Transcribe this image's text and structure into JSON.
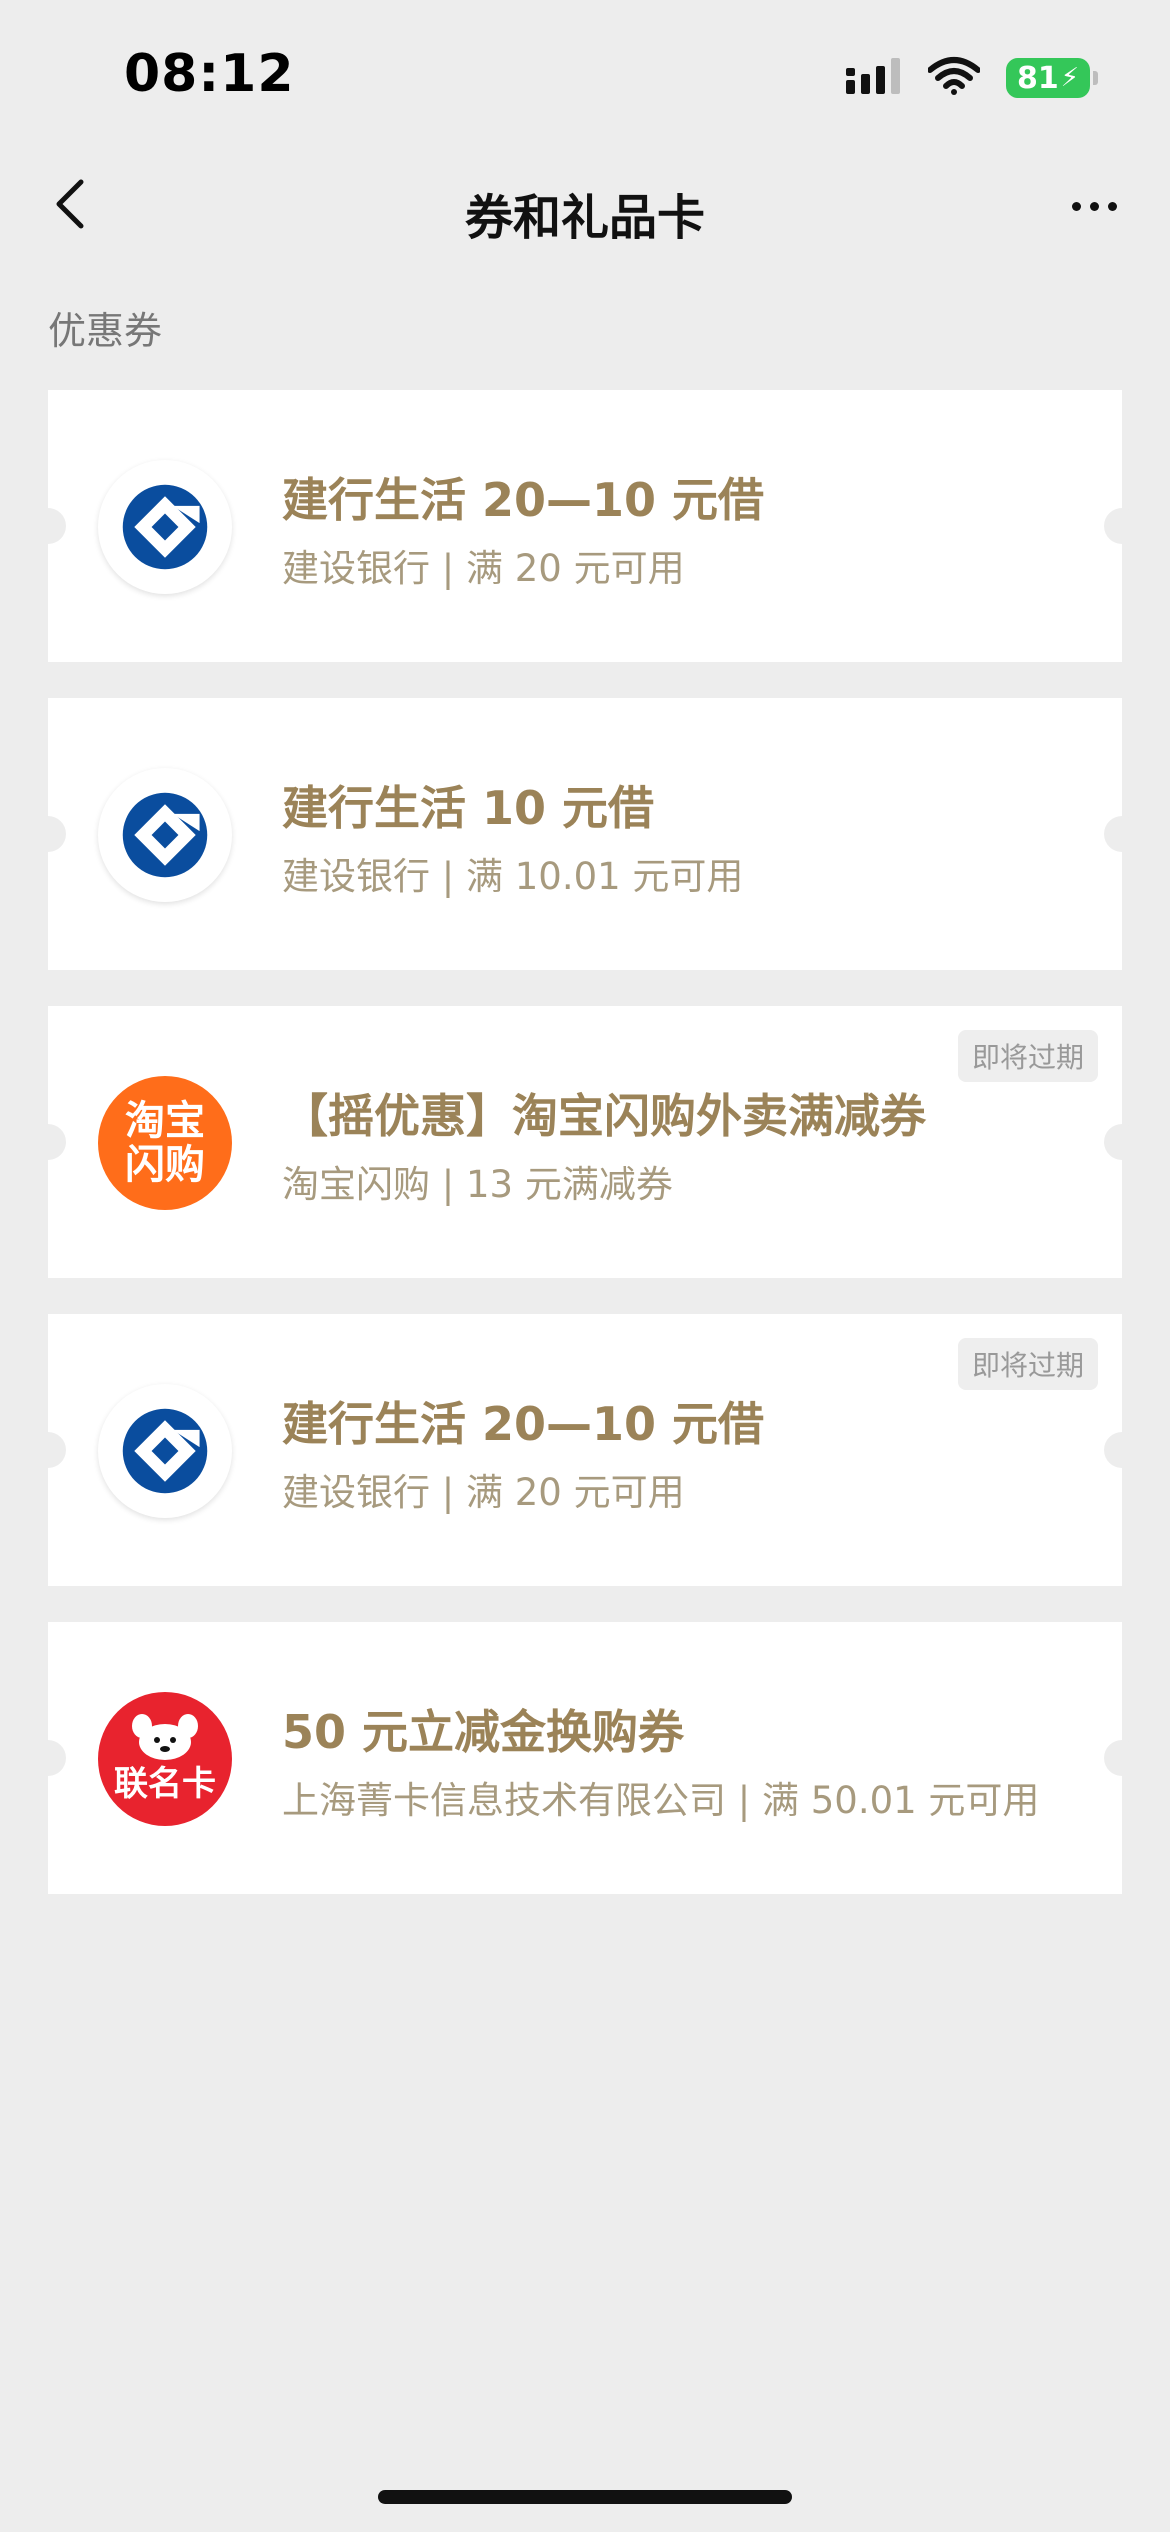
{
  "status_bar": {
    "time": "08:12",
    "battery": "81",
    "icons": [
      "signal-icon",
      "wifi-icon",
      "battery-icon",
      "charging-icon"
    ]
  },
  "nav": {
    "title": "券和礼品卡",
    "back_icon": "chevron-left-icon",
    "more_icon": "more-dots-icon"
  },
  "section": {
    "label": "优惠券"
  },
  "coupons": [
    {
      "logo": "ccb-logo",
      "title": "建行生活 20—10 元借",
      "sub": "建设银行 | 满 20 元可用",
      "badge": ""
    },
    {
      "logo": "ccb-logo",
      "title": "建行生活 10 元借",
      "sub": "建设银行 | 满 10.01 元可用",
      "badge": ""
    },
    {
      "logo": "taobao-flash-logo",
      "logo_text": [
        "淘宝",
        "闪购"
      ],
      "title": "【摇优惠】淘宝闪购外卖满减券",
      "sub": "淘宝闪购 | 13 元满减券",
      "badge": "即将过期"
    },
    {
      "logo": "ccb-logo",
      "title": "建行生活 20—10 元借",
      "sub": "建设银行 | 满 20 元可用",
      "badge": "即将过期"
    },
    {
      "logo": "union-card-logo",
      "logo_text": "联名卡",
      "title": "50 元立减金换购券",
      "sub": "上海菁卡信息技术有限公司 | 满 50.01 元可用",
      "badge": ""
    }
  ],
  "colors": {
    "background": "#ededed",
    "title_gold": "#9b8358",
    "sub_gold": "#a79a7e",
    "ccb_blue": "#0a4d9e",
    "taobao_orange": "#ff6d1a",
    "union_red": "#e8232e",
    "battery_green": "#34c759"
  }
}
